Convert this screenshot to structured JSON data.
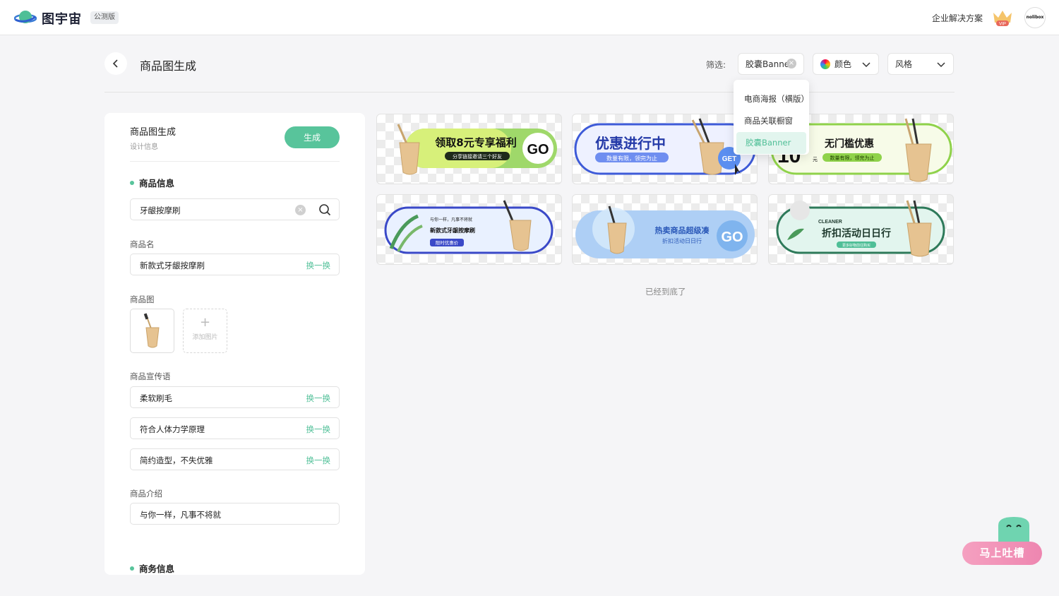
{
  "app": {
    "logo_text": "图宇宙",
    "badge": "公测版",
    "enterprise_link": "企业解决方案",
    "vip_label": "VIP",
    "avatar_text": "nolibox"
  },
  "header": {
    "title": "商品图生成",
    "filter_label": "筛选:"
  },
  "filters": {
    "type": "胶囊Banner",
    "color": "颜色",
    "style": "风格"
  },
  "dropdown": {
    "items": [
      "电商海报（横版）",
      "商品关联橱窗",
      "胶囊Banner"
    ],
    "selected": "胶囊Banner"
  },
  "panel": {
    "title": "商品图生成",
    "subtitle": "设计信息",
    "generate": "生成",
    "product_info": "商品信息",
    "search_value": "牙龈按摩刷",
    "name_label": "商品名",
    "name_value": "新款式牙龈按摩刷",
    "swap": "换一换",
    "image_label": "商品图",
    "add_image": "添加图片",
    "slogan_label": "商品宣传语",
    "slogans": [
      "柔软刷毛",
      "符合人体力学原理",
      "简约造型，不失优雅"
    ],
    "intro_label": "商品介绍",
    "intro_value": "与你一样，凡事不将就",
    "business_info": "商务信息"
  },
  "banners": [
    {
      "headline": "领取8元专享福利",
      "sub": "分享链接邀请三个好友",
      "cta": "GO"
    },
    {
      "headline": "优惠进行中",
      "sub": "数量有限，领完为止",
      "cta": "GET"
    },
    {
      "headline": "无门槛优惠",
      "sub": "数量有限，领完为止",
      "num": "10",
      "unit": "元"
    },
    {
      "top": "与你一样，凡事不将就",
      "headline": "新款式牙龈按摩刷",
      "sub": "限时优惠价"
    },
    {
      "headline": "热卖商品超级凑",
      "sub": "折扣活动日日行",
      "cta": "GO"
    },
    {
      "top": "CLEANER",
      "headline": "折扣活动日日行",
      "sub": "更多好物前往购买"
    }
  ],
  "end_text": "已经到底了",
  "feedback": "马上吐槽"
}
